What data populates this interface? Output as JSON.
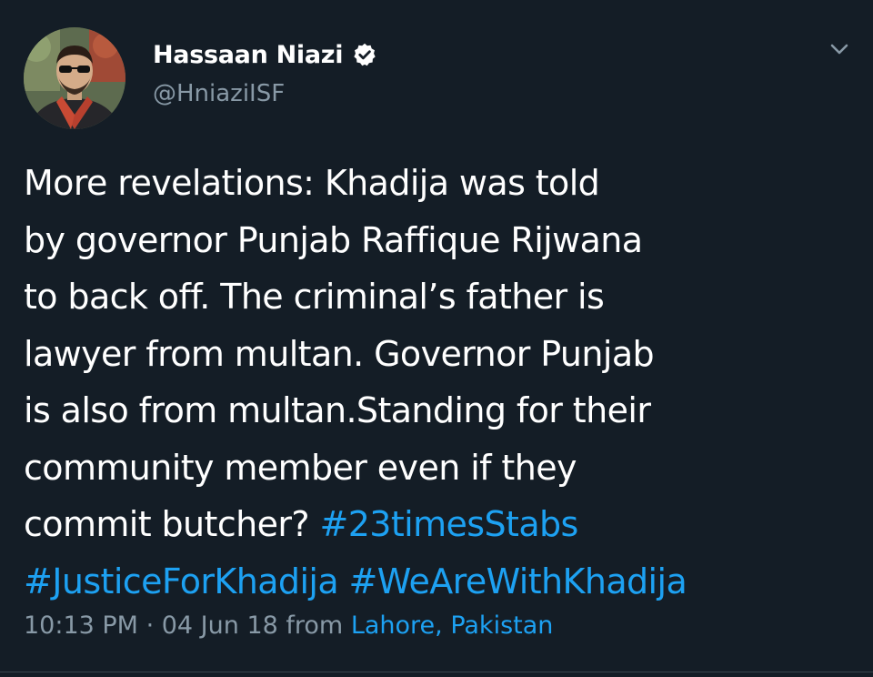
{
  "author": {
    "display_name": "Hassaan Niazi",
    "handle": "@HniaziISF",
    "verified": true,
    "avatar_icon": "profile-photo"
  },
  "tweet": {
    "lines": [
      {
        "text": "More revelations: Khadija was told",
        "hashtags": ""
      },
      {
        "text": "by governor Punjab Raffique Rijwana",
        "hashtags": ""
      },
      {
        "text": "to back off. The criminal’s father is",
        "hashtags": ""
      },
      {
        "text": "lawyer from multan. Governor Punjab",
        "hashtags": ""
      },
      {
        "text": "is also from multan.Standing for their",
        "hashtags": ""
      },
      {
        "text": "community member even if they",
        "hashtags": ""
      },
      {
        "text": "commit butcher? ",
        "hashtags": "#23timesStabs"
      },
      {
        "text": "",
        "hashtags": "#JusticeForKhadija #WeAreWithKhadija"
      }
    ]
  },
  "meta": {
    "time": "10:13 PM",
    "separator": " · ",
    "date": "04 Jun 18",
    "from_label": " from ",
    "location": "Lahore, Pakistan"
  },
  "icons": {
    "verified": "verified-badge-icon",
    "caret": "chevron-down-icon"
  },
  "colors": {
    "background": "#141d26",
    "text": "#ffffff",
    "secondary": "#8899a6",
    "link": "#1da1f2"
  }
}
